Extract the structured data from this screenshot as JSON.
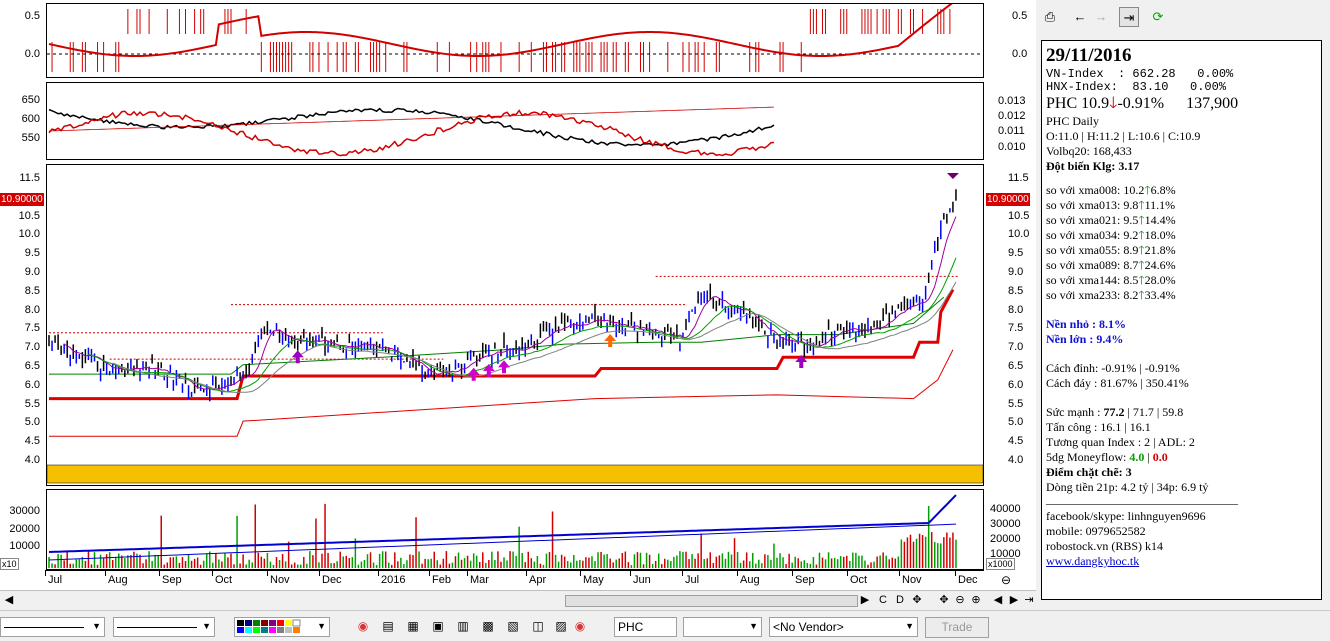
{
  "chart": {
    "osc_axis": [
      "0.5",
      "0.0"
    ],
    "index_axis_left": [
      "650",
      "600",
      "550"
    ],
    "index_axis_right": [
      "0.013",
      "0.012",
      "0.011",
      "0.010"
    ],
    "price_axis": [
      "11.5",
      "11.0",
      "10.5",
      "10.0",
      "9.5",
      "9.0",
      "8.5",
      "8.0",
      "7.5",
      "7.0",
      "6.5",
      "6.0",
      "5.5",
      "5.0",
      "4.5",
      "4.0"
    ],
    "price_tag": "10.90000",
    "volume_axis_left": [
      "30000",
      "20000",
      "10000"
    ],
    "volume_axis_right": [
      "40000",
      "30000",
      "20000",
      "10000"
    ],
    "volume_unit": "x10",
    "volume_unit_right": "x1000",
    "months": [
      "Jul",
      "Aug",
      "Sep",
      "Oct",
      "Nov",
      "Dec",
      "2016",
      "Feb",
      "Mar",
      "Apr",
      "May",
      "Jun",
      "Jul",
      "Aug",
      "Sep",
      "Oct",
      "Nov",
      "Dec"
    ],
    "colors": {
      "price_up": "#0000ff",
      "price_down": "#000000",
      "stop_line": "#e00000",
      "ma_green": "#008000",
      "band": "#f5c000"
    }
  },
  "scrollbar": {
    "buttons": [
      "C",
      "D",
      "✥",
      "⊖",
      "⊕",
      "◀",
      "▶"
    ]
  },
  "bottom_bar": {
    "symbol": "PHC",
    "vendor": "<No Vendor>",
    "trade_label": "Trade"
  },
  "info": {
    "date": "29/11/2016",
    "vnindex": "VN-Index  : 662.28   0.00%",
    "hnxindex": "HNX-Index:  83.10   0.00%",
    "ticker": "PHC 10.9",
    "change": "-0.91%",
    "volume": "137,900",
    "title": "PHC Daily",
    "ohlc": "O:11.0  | H:11.2  | L:10.6  | C:10.9",
    "volbq": "Volbq20: 168,433",
    "dotbien": "Đột biến Klg: 3.17",
    "ma_rows": [
      {
        "label": "so với xma008:",
        "val": "10.2",
        "pct": "6.8%"
      },
      {
        "label": "so với xma013:",
        "val": "9.8",
        "pct": "11.1%"
      },
      {
        "label": "so với xma021:",
        "val": "9.5",
        "pct": "14.4%"
      },
      {
        "label": "so với xma034:",
        "val": "9.2",
        "pct": "18.0%"
      },
      {
        "label": "so với xma055:",
        "val": "8.9",
        "pct": "21.8%"
      },
      {
        "label": "so với xma089:",
        "val": "8.7",
        "pct": "24.6%"
      },
      {
        "label": "so với xma144:",
        "val": "8.5",
        "pct": "28.0%"
      },
      {
        "label": "so với xma233:",
        "val": "8.2",
        "pct": "33.4%"
      }
    ],
    "nen_nho": "Nền nhỏ : 8.1%",
    "nen_lon": "Nền lớn : 9.4%",
    "cach_dinh": "Cách đỉnh: -0.91% | -0.91%",
    "cach_day": "Cách đáy : 81.67% | 350.41%",
    "suc_manh_label": "Sức mạnh : ",
    "suc_manh_bold": "77.2",
    "suc_manh_rest": " | 71.7 | 59.8",
    "tan_cong": "Tấn công : 16.1 | 16.1",
    "tuong_quan": "Tương quan Index : 2 | ADL: 2",
    "moneyflow_label": "5dg Moneyflow: ",
    "moneyflow_up": "4.0",
    "moneyflow_down": "0.0",
    "diem": "Điểm chặt chẽ: 3",
    "dong_tien": "Dòng tiền 21p: 4.2 tỷ | 34p: 6.9 tỷ",
    "separator": "________________________________",
    "facebook": "facebook/skype: linhnguyen9696",
    "mobile": "mobile: 0979652582",
    "robostock": "robostock.vn (RBS) k14",
    "website": "www.dangkyhoc.tk"
  }
}
